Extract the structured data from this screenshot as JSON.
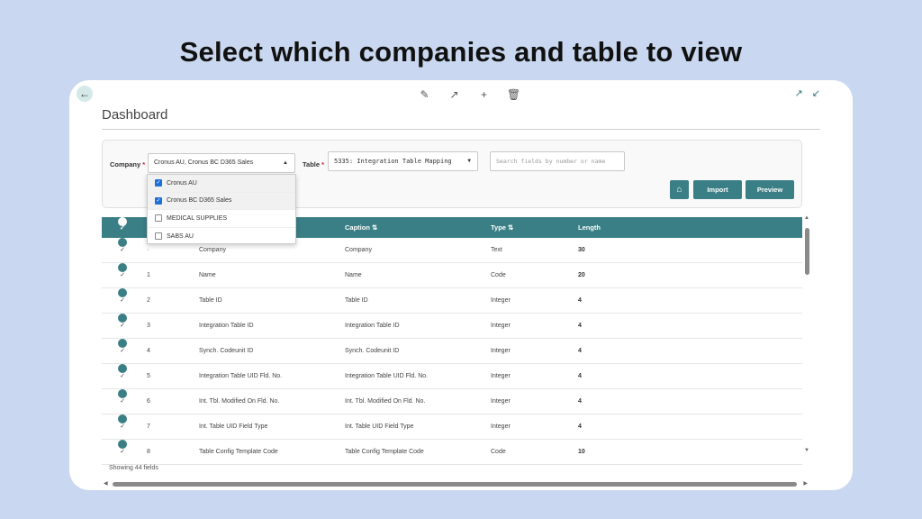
{
  "headline": "Select which companies and table to view",
  "page": {
    "title": "Dashboard"
  },
  "filters": {
    "company_label": "Company",
    "company_value": "Cronus AU, Cronus BC D365 Sales",
    "table_label": "Table",
    "table_value": "5335: Integration Table Mapping",
    "search_placeholder": "Search fields by number or name",
    "required_mark": "*"
  },
  "company_options": [
    {
      "label": "Cronus AU",
      "checked": true
    },
    {
      "label": "Cronus BC D365 Sales",
      "checked": true
    },
    {
      "label": "MEDICAL SUPPLIES",
      "checked": false
    },
    {
      "label": "SABS AU",
      "checked": false
    }
  ],
  "buttons": {
    "import": "Import",
    "preview": "Preview"
  },
  "grid": {
    "headers": {
      "caption": "Caption ⇅",
      "type": "Type ⇅",
      "length": "Length"
    },
    "rows": [
      {
        "no": "·",
        "name": "Company",
        "caption": "Company",
        "type": "Text",
        "length": "30"
      },
      {
        "no": "1",
        "name": "Name",
        "caption": "Name",
        "type": "Code",
        "length": "20"
      },
      {
        "no": "2",
        "name": "Table ID",
        "caption": "Table ID",
        "type": "Integer",
        "length": "4"
      },
      {
        "no": "3",
        "name": "Integration Table ID",
        "caption": "Integration Table ID",
        "type": "Integer",
        "length": "4"
      },
      {
        "no": "4",
        "name": "Synch. Codeunit ID",
        "caption": "Synch. Codeunit ID",
        "type": "Integer",
        "length": "4"
      },
      {
        "no": "5",
        "name": "Integration Table UID Fld. No.",
        "caption": "Integration Table UID Fld. No.",
        "type": "Integer",
        "length": "4"
      },
      {
        "no": "6",
        "name": "Int. Tbl. Modified On Fld. No.",
        "caption": "Int. Tbl. Modified On Fld. No.",
        "type": "Integer",
        "length": "4"
      },
      {
        "no": "7",
        "name": "Int. Table UID Field Type",
        "caption": "Int. Table UID Field Type",
        "type": "Integer",
        "length": "4"
      },
      {
        "no": "8",
        "name": "Table Config Template Code",
        "caption": "Table Config Template Code",
        "type": "Code",
        "length": "10"
      }
    ],
    "footer": "Showing 44 fields"
  },
  "colors": {
    "accent": "#3a7f85",
    "background": "#c9d8f0"
  }
}
